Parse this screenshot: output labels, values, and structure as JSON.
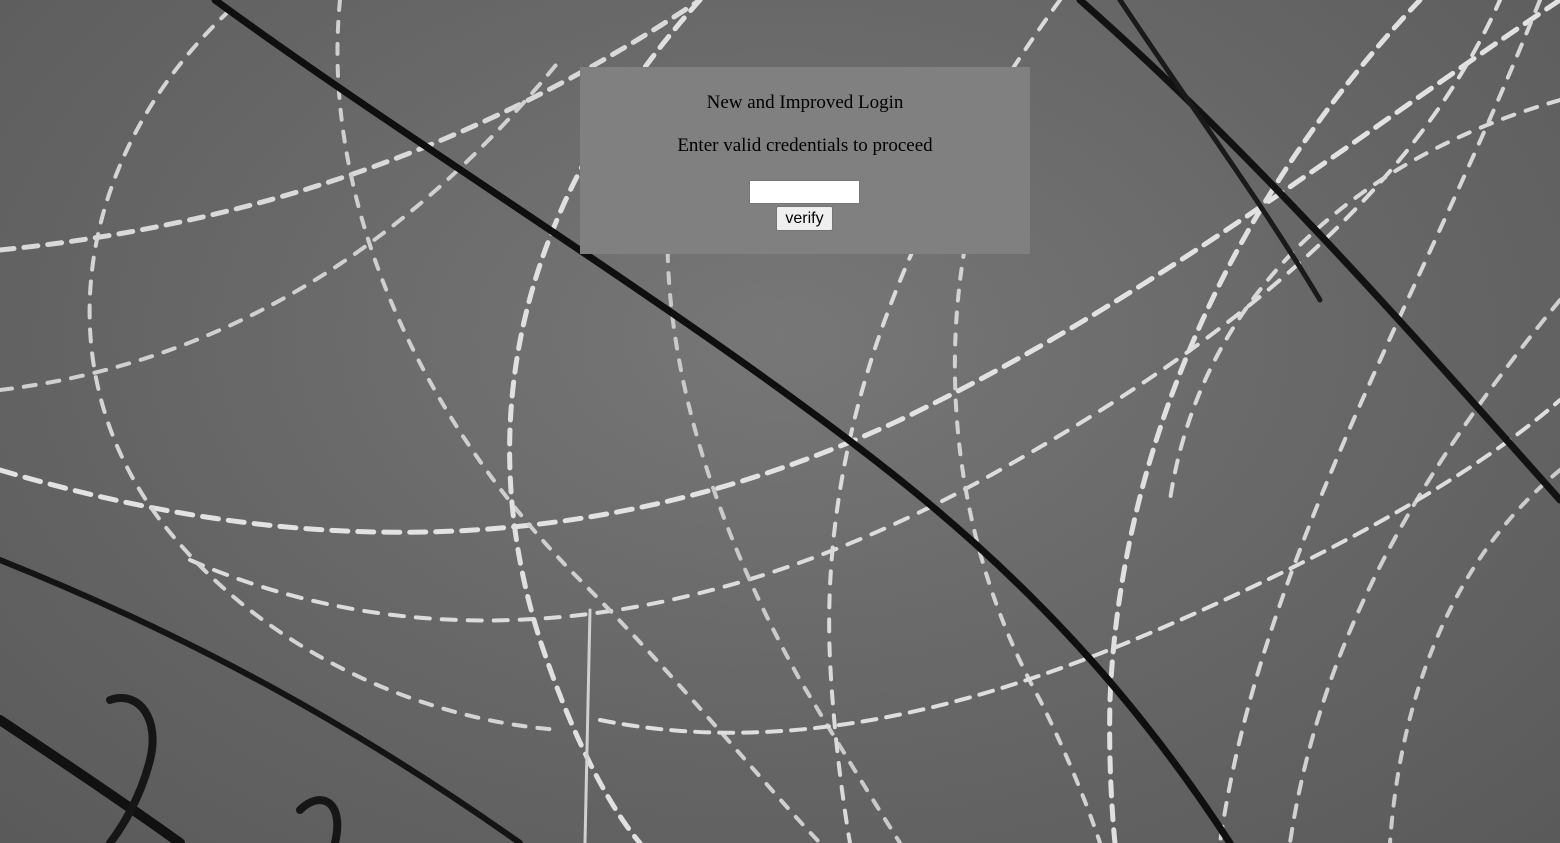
{
  "login": {
    "title": "New and Improved Login",
    "subtitle": "Enter valid credentials to proceed",
    "credential_value": "",
    "verify_label": "verify"
  },
  "colors": {
    "panel": "#808080",
    "background": "#6a6a6a",
    "wire_light": "#e8e8e8",
    "wire_dark": "#111111"
  },
  "icons": {
    "background": "barbed-wire-photo"
  }
}
